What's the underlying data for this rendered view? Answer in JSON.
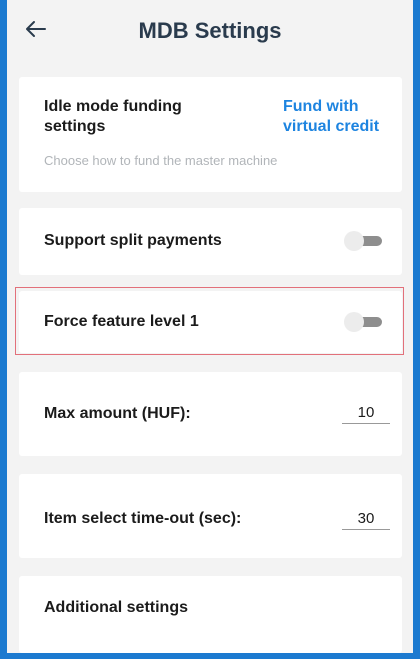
{
  "header": {
    "back_icon": "arrow-left-icon",
    "title": "MDB Settings"
  },
  "funding": {
    "label": "Idle mode funding settings",
    "value": "Fund with virtual credit",
    "description": "Choose how to fund the master machine"
  },
  "split_payments": {
    "label": "Support split payments",
    "enabled": false
  },
  "force_feature": {
    "label": "Force feature level 1",
    "enabled": false
  },
  "max_amount": {
    "label": "Max amount (HUF):",
    "value": "10"
  },
  "item_timeout": {
    "label": "Item select time-out (sec):",
    "value": "30"
  },
  "additional": {
    "label": "Additional settings"
  },
  "colors": {
    "frame": "#1c7ad0",
    "background": "#f3f3f3",
    "accent": "#1d84e0",
    "highlight": "#e2707a"
  }
}
